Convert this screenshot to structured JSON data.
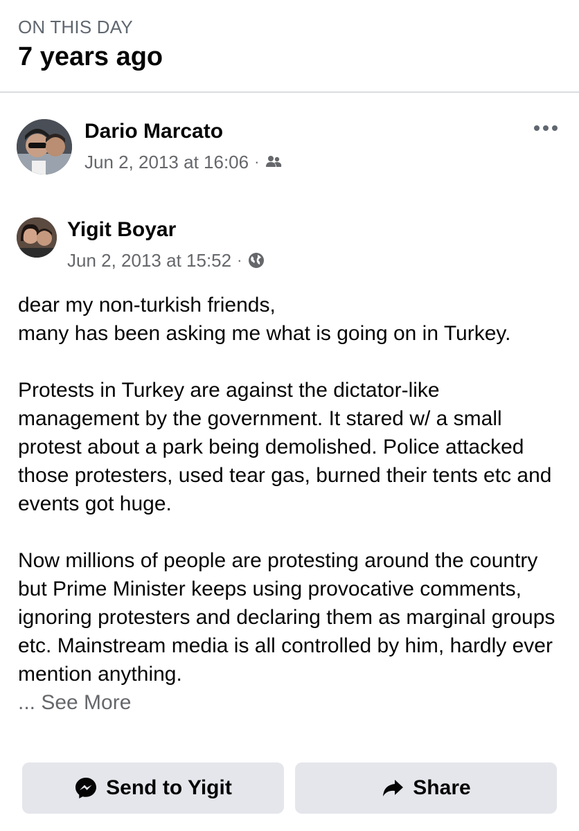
{
  "memory": {
    "kicker": "ON THIS DAY",
    "title": "7 years ago"
  },
  "post": {
    "author": "Dario Marcato",
    "timestamp": "Jun 2, 2013 at 16:06",
    "separator": "·",
    "audience_icon": "friends-icon",
    "more_icon": "more-options-icon"
  },
  "shared": {
    "author": "Yigit Boyar",
    "timestamp": "Jun 2, 2013 at 15:52",
    "separator": "·",
    "audience_icon": "globe-icon",
    "lines": [
      "dear my non-turkish friends,",
      "many has been asking me what is going on in Turkey.",
      "Protests in Turkey are against the dictator-like management by the government. It stared w/ a small protest about a park being demolished. Police attacked those protesters,  used tear gas, burned their tents etc and events got huge.",
      "Now millions of people are protesting around the country but Prime Minister keeps using provocative comments, ignoring protesters and declaring them as marginal groups etc. Mainstream media is all controlled by him, hardly ever mention anything."
    ],
    "see_more": "... See More"
  },
  "actions": {
    "send_label": "Send to Yigit",
    "send_icon": "messenger-icon",
    "share_label": "Share",
    "share_icon": "share-arrow-icon"
  },
  "colors": {
    "secondary_text": "#65676b",
    "button_bg": "#e4e6eb",
    "divider": "#dadde1"
  }
}
